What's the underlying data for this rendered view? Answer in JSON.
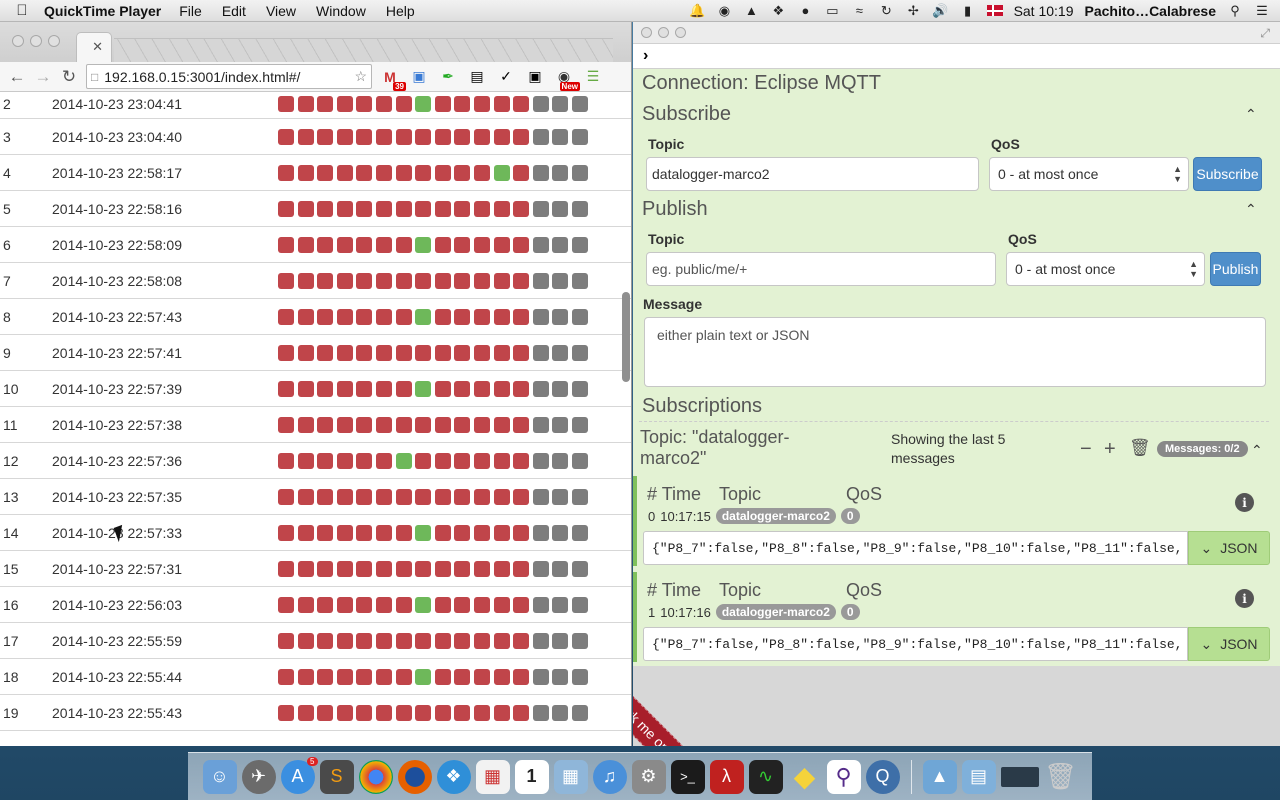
{
  "menubar": {
    "app_name": "QuickTime Player",
    "menus": [
      "File",
      "Edit",
      "View",
      "Window",
      "Help"
    ],
    "clock": "Sat 10:19",
    "user": "Pachito…Calabrese"
  },
  "browser": {
    "url": "192.168.0.15:3001/index.html#/",
    "extension_badge": "39",
    "new_badge": "New",
    "rows": [
      {
        "idx": "2",
        "ts": "2014-10-23 23:04:41",
        "leds": "rrrrrrrgrrrrrxxx"
      },
      {
        "idx": "3",
        "ts": "2014-10-23 23:04:40",
        "leds": "rrrrrrrrrrrrrxxx"
      },
      {
        "idx": "4",
        "ts": "2014-10-23 22:58:17",
        "leds": "rrrrrrrrrrrgrxxx"
      },
      {
        "idx": "5",
        "ts": "2014-10-23 22:58:16",
        "leds": "rrrrrrrrrrrrrxxx"
      },
      {
        "idx": "6",
        "ts": "2014-10-23 22:58:09",
        "leds": "rrrrrrrgrrrrrxxx"
      },
      {
        "idx": "7",
        "ts": "2014-10-23 22:58:08",
        "leds": "rrrrrrrrrrrrrxxx"
      },
      {
        "idx": "8",
        "ts": "2014-10-23 22:57:43",
        "leds": "rrrrrrrgrrrrrxxx"
      },
      {
        "idx": "9",
        "ts": "2014-10-23 22:57:41",
        "leds": "rrrrrrrrrrrrrxxx"
      },
      {
        "idx": "10",
        "ts": "2014-10-23 22:57:39",
        "leds": "rrrrrrrgrrrrrxxx"
      },
      {
        "idx": "11",
        "ts": "2014-10-23 22:57:38",
        "leds": "rrrrrrrrrrrrrxxx"
      },
      {
        "idx": "12",
        "ts": "2014-10-23 22:57:36",
        "leds": "rrrrrrgrrrrrrxxx"
      },
      {
        "idx": "13",
        "ts": "2014-10-23 22:57:35",
        "leds": "rrrrrrrrrrrrrxxx"
      },
      {
        "idx": "14",
        "ts": "2014-10-23 22:57:33",
        "leds": "rrrrrrrgrrrrrxxx"
      },
      {
        "idx": "15",
        "ts": "2014-10-23 22:57:31",
        "leds": "rrrrrrrrrrrrrxxx"
      },
      {
        "idx": "16",
        "ts": "2014-10-23 22:56:03",
        "leds": "rrrrrrrgrrrrrxxx"
      },
      {
        "idx": "17",
        "ts": "2014-10-23 22:55:59",
        "leds": "rrrrrrrrrrrrrxxx"
      },
      {
        "idx": "18",
        "ts": "2014-10-23 22:55:44",
        "leds": "rrrrrrrgrrrrrxxx"
      },
      {
        "idx": "19",
        "ts": "2014-10-23 22:55:43",
        "leds": "rrrrrrrrrrrrrxxx"
      }
    ],
    "colors": {
      "led_off": "#c0454a",
      "led_on": "#6eb85a",
      "led_unused": "#7d7d7d"
    }
  },
  "mqtt": {
    "cmd_prompt": "›",
    "connection_title": "Connection: Eclipse MQTT",
    "subscribe": {
      "heading": "Subscribe",
      "topic_label": "Topic",
      "topic_value": "datalogger-marco2",
      "qos_label": "QoS",
      "qos_value": "0 - at most once",
      "button": "Subscribe"
    },
    "publish": {
      "heading": "Publish",
      "topic_label": "Topic",
      "topic_placeholder": "eg. public/me/+",
      "qos_label": "QoS",
      "qos_value": "0 - at most once",
      "button": "Publish",
      "message_label": "Message",
      "message_placeholder": "either plain text or JSON"
    },
    "subscriptions": {
      "heading": "Subscriptions",
      "topic_title": "Topic: \"datalogger-marco2\"",
      "showing": "Showing the last 5 messages",
      "messages_badge": "Messages: 0/2",
      "columns": {
        "num": "#",
        "time": "Time",
        "topic": "Topic",
        "qos": "QoS"
      },
      "messages": [
        {
          "num": "0",
          "time": "10:17:15",
          "topic": "datalogger-marco2",
          "qos": "0",
          "payload": "{\"P8_7\":false,\"P8_8\":false,\"P8_9\":false,\"P8_10\":false,\"P8_11\":false,",
          "format": "JSON"
        },
        {
          "num": "1",
          "time": "10:17:16",
          "topic": "datalogger-marco2",
          "qos": "0",
          "payload": "{\"P8_7\":false,\"P8_8\":false,\"P8_9\":false,\"P8_10\":false,\"P8_11\":false,",
          "format": "JSON"
        }
      ]
    },
    "ribbon": "Fork me on GitHub"
  },
  "dock": {
    "icons": [
      "finder-icon",
      "launchpad-icon",
      "app-store-icon",
      "sublime-icon",
      "chrome-icon",
      "firefox-icon",
      "safari-icon",
      "grid-app-icon",
      "calendar-icon",
      "preview-icon",
      "itunes-icon",
      "system-prefs-icon",
      "terminal-icon",
      "acrobat-icon",
      "activity-monitor-icon",
      "cheese-icon",
      "search-app-icon",
      "quicktime-icon"
    ],
    "calendar_day": "1",
    "app_store_badge": "5"
  }
}
